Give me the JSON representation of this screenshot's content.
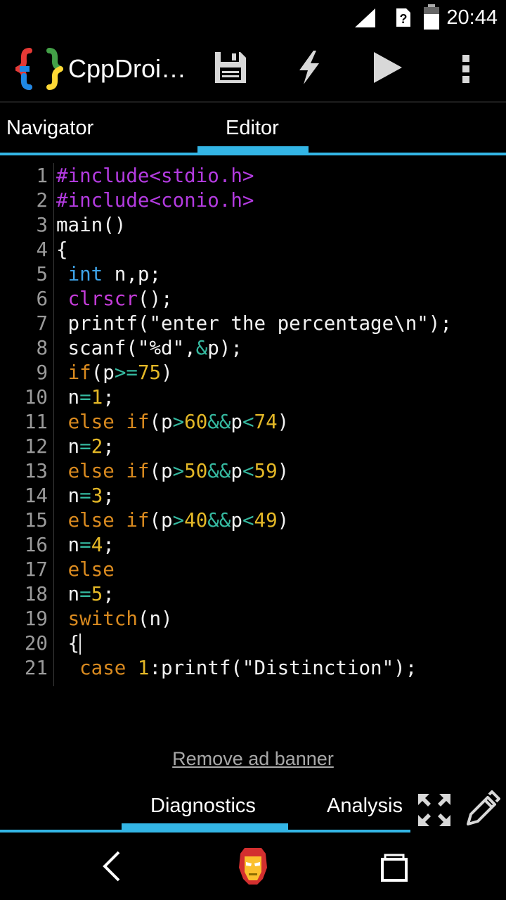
{
  "status_bar": {
    "time": "20:44",
    "icons": [
      "signal-icon",
      "sim-unknown-icon",
      "battery-icon"
    ]
  },
  "action_bar": {
    "app_title": "CppDroi…",
    "logo": "cppdroid-braces-logo",
    "actions": [
      "save-icon",
      "build-flash-icon",
      "run-play-icon",
      "overflow-menu-icon"
    ]
  },
  "tabs": {
    "navigator": "Navigator",
    "editor": "Editor",
    "active": "Editor"
  },
  "editor": {
    "line_numbers": [
      "1",
      "2",
      "3",
      "4",
      "5",
      "6",
      "7",
      "8",
      "9",
      "10",
      "11",
      "12",
      "13",
      "14",
      "15",
      "16",
      "17",
      "18",
      "19",
      "20",
      "21"
    ],
    "lines": [
      [
        {
          "t": "#include<stdio.h>",
          "c": "pre"
        }
      ],
      [
        {
          "t": "#include<conio.h>",
          "c": "pre"
        }
      ],
      [
        {
          "t": "main()",
          "c": ""
        }
      ],
      [
        {
          "t": "{",
          "c": ""
        }
      ],
      [
        {
          "t": " ",
          "c": ""
        },
        {
          "t": "int",
          "c": "type"
        },
        {
          "t": " n,p;",
          "c": ""
        }
      ],
      [
        {
          "t": " ",
          "c": ""
        },
        {
          "t": "clrscr",
          "c": "fn"
        },
        {
          "t": "();",
          "c": ""
        }
      ],
      [
        {
          "t": " printf(\"enter the percentage\\n\");",
          "c": ""
        }
      ],
      [
        {
          "t": " scanf(\"%d\",",
          "c": ""
        },
        {
          "t": "&",
          "c": "op"
        },
        {
          "t": "p);",
          "c": ""
        }
      ],
      [
        {
          "t": " ",
          "c": ""
        },
        {
          "t": "if",
          "c": "kw"
        },
        {
          "t": "(p",
          "c": ""
        },
        {
          "t": ">=",
          "c": "op"
        },
        {
          "t": "75",
          "c": "num"
        },
        {
          "t": ")",
          "c": ""
        }
      ],
      [
        {
          "t": " n",
          "c": ""
        },
        {
          "t": "=",
          "c": "op"
        },
        {
          "t": "1",
          "c": "num"
        },
        {
          "t": ";",
          "c": ""
        }
      ],
      [
        {
          "t": " ",
          "c": ""
        },
        {
          "t": "else",
          "c": "kw"
        },
        {
          "t": " ",
          "c": ""
        },
        {
          "t": "if",
          "c": "kw"
        },
        {
          "t": "(p",
          "c": ""
        },
        {
          "t": ">",
          "c": "op"
        },
        {
          "t": "60",
          "c": "num"
        },
        {
          "t": "&&",
          "c": "op"
        },
        {
          "t": "p",
          "c": ""
        },
        {
          "t": "<",
          "c": "op"
        },
        {
          "t": "74",
          "c": "num"
        },
        {
          "t": ")",
          "c": ""
        }
      ],
      [
        {
          "t": " n",
          "c": ""
        },
        {
          "t": "=",
          "c": "op"
        },
        {
          "t": "2",
          "c": "num"
        },
        {
          "t": ";",
          "c": ""
        }
      ],
      [
        {
          "t": " ",
          "c": ""
        },
        {
          "t": "else",
          "c": "kw"
        },
        {
          "t": " ",
          "c": ""
        },
        {
          "t": "if",
          "c": "kw"
        },
        {
          "t": "(p",
          "c": ""
        },
        {
          "t": ">",
          "c": "op"
        },
        {
          "t": "50",
          "c": "num"
        },
        {
          "t": "&&",
          "c": "op"
        },
        {
          "t": "p",
          "c": ""
        },
        {
          "t": "<",
          "c": "op"
        },
        {
          "t": "59",
          "c": "num"
        },
        {
          "t": ")",
          "c": ""
        }
      ],
      [
        {
          "t": " n",
          "c": ""
        },
        {
          "t": "=",
          "c": "op"
        },
        {
          "t": "3",
          "c": "num"
        },
        {
          "t": ";",
          "c": ""
        }
      ],
      [
        {
          "t": " ",
          "c": ""
        },
        {
          "t": "else",
          "c": "kw"
        },
        {
          "t": " ",
          "c": ""
        },
        {
          "t": "if",
          "c": "kw"
        },
        {
          "t": "(p",
          "c": ""
        },
        {
          "t": ">",
          "c": "op"
        },
        {
          "t": "40",
          "c": "num"
        },
        {
          "t": "&&",
          "c": "op"
        },
        {
          "t": "p",
          "c": ""
        },
        {
          "t": "<",
          "c": "op"
        },
        {
          "t": "49",
          "c": "num"
        },
        {
          "t": ")",
          "c": ""
        }
      ],
      [
        {
          "t": " n",
          "c": ""
        },
        {
          "t": "=",
          "c": "op"
        },
        {
          "t": "4",
          "c": "num"
        },
        {
          "t": ";",
          "c": ""
        }
      ],
      [
        {
          "t": " ",
          "c": ""
        },
        {
          "t": "else",
          "c": "kw"
        }
      ],
      [
        {
          "t": " n",
          "c": ""
        },
        {
          "t": "=",
          "c": "op"
        },
        {
          "t": "5",
          "c": "num"
        },
        {
          "t": ";",
          "c": ""
        }
      ],
      [
        {
          "t": " ",
          "c": ""
        },
        {
          "t": "switch",
          "c": "kw"
        },
        {
          "t": "(n)",
          "c": ""
        }
      ],
      [
        {
          "t": " {",
          "c": ""
        },
        {
          "t": "",
          "c": "caret"
        }
      ],
      [
        {
          "t": "  ",
          "c": ""
        },
        {
          "t": "case",
          "c": "kw"
        },
        {
          "t": " ",
          "c": ""
        },
        {
          "t": "1",
          "c": "num"
        },
        {
          "t": ":printf(\"Distinction\");",
          "c": ""
        }
      ]
    ]
  },
  "ad": {
    "remove_link": "Remove ad banner"
  },
  "bottom_tabs": {
    "diagnostics": "Diagnostics",
    "analysis": "Analysis",
    "active": "Diagnostics",
    "icons": [
      "fullscreen-expand-icon",
      "edit-pencil-icon"
    ]
  },
  "nav_bar": {
    "buttons": [
      "back-icon",
      "home-ironman-icon",
      "recents-icon"
    ]
  },
  "colors": {
    "accent": "#33b5e5",
    "preprocessor": "#b33be0",
    "type": "#3ea3e8",
    "function": "#c43cd8",
    "keyword": "#d98a1f",
    "number": "#e4b827",
    "operator": "#35b89f",
    "text": "#f2f2f2",
    "line_number": "#9a9a9a"
  }
}
